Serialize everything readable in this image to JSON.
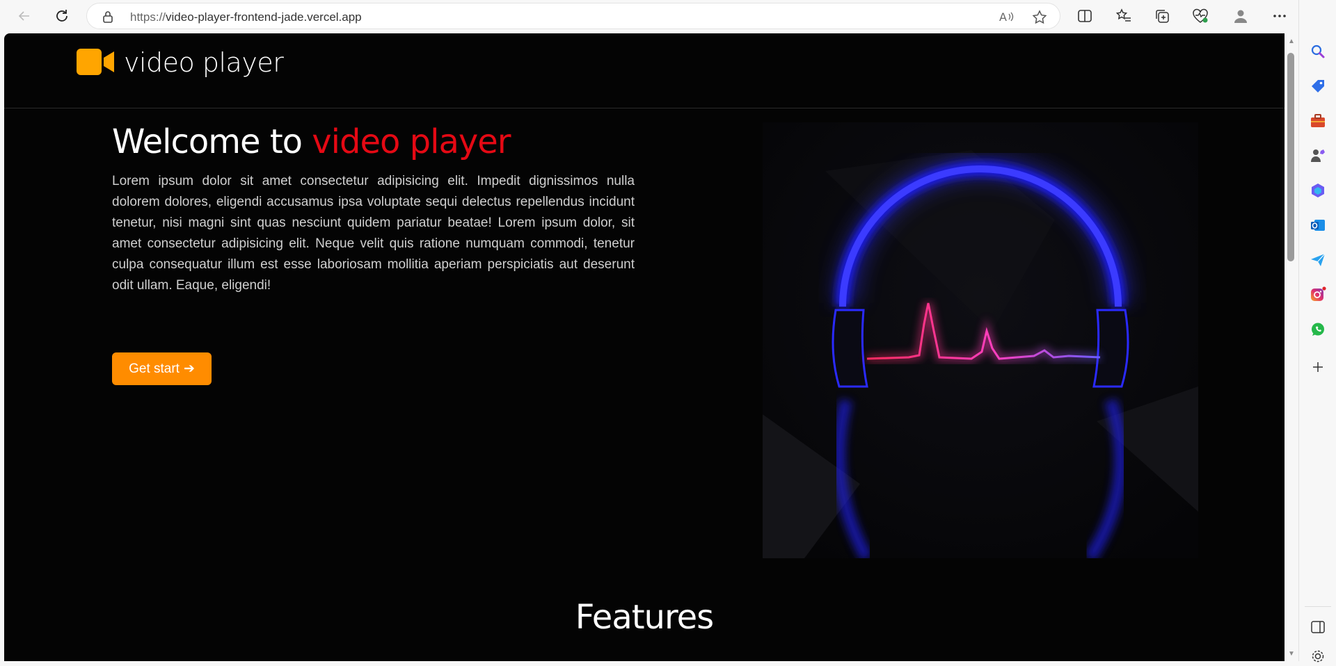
{
  "browser": {
    "url_protocol": "https://",
    "url_host": "video-player-frontend-jade.vercel.app"
  },
  "site": {
    "logo_text": "video player",
    "hero": {
      "title_prefix": "Welcome to ",
      "title_accent": "video player",
      "paragraph": "Lorem ipsum dolor sit amet consectetur adipisicing elit. Impedit dignissimos nulla dolorem dolores, eligendi accusamus ipsa voluptate sequi delectus repellendus incidunt tenetur, nisi magni sint quas nesciunt quidem pariatur beatae! Lorem ipsum dolor, sit amet consectetur adipisicing elit. Neque velit quis ratione numquam commodi, tenetur culpa consequatur illum est esse laboriosam mollitia aperiam perspiciatis aut deserunt odit ullam. Eaque, eligendi!",
      "cta_label": "Get start",
      "cta_arrow": "➔"
    },
    "features_title": "Features"
  },
  "colors": {
    "accent_orange": "#ff8c00",
    "accent_red": "#e50914",
    "page_bg": "#040404"
  },
  "icons": {
    "back": "back-arrow-icon",
    "refresh": "refresh-icon",
    "lock": "lock-icon",
    "read_aloud": "read-aloud-icon",
    "favorite": "star-icon",
    "split_screen": "split-screen-icon",
    "favorites": "favorites-icon",
    "collections": "collections-icon",
    "performance": "heart-pulse-icon",
    "profile": "profile-icon",
    "more": "more-icon",
    "copilot": "copilot-icon"
  }
}
